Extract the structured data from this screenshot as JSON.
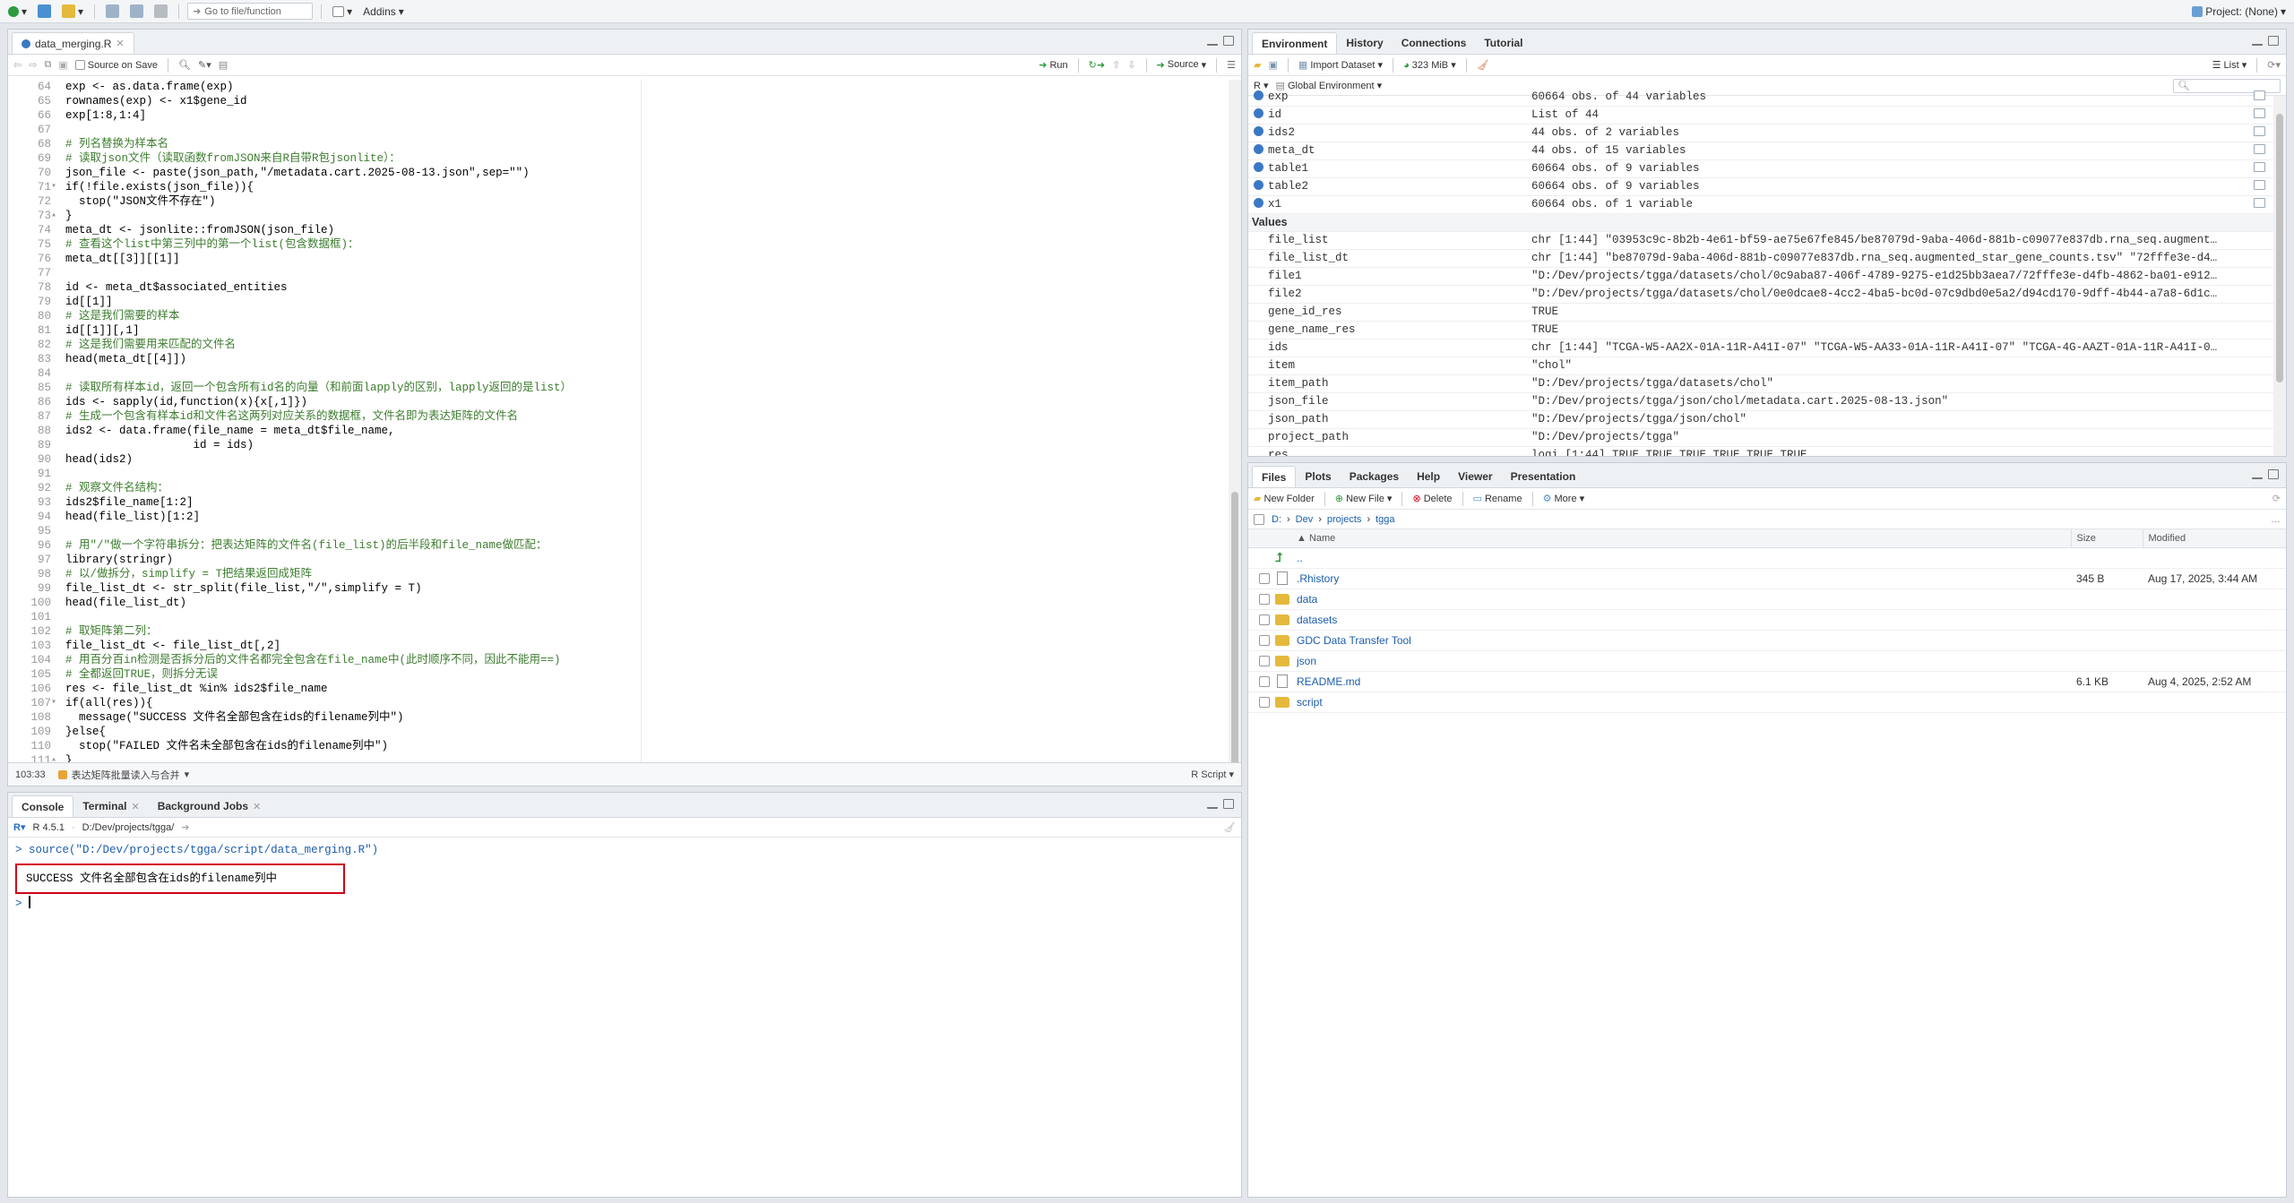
{
  "toolbar": {
    "goto_placeholder": "Go to file/function",
    "addins_label": "Addins",
    "project_label": "Project: (None)"
  },
  "editor": {
    "tab_label": "data_merging.R",
    "source_on_save_label": "Source on Save",
    "run_label": "Run",
    "source_label": "Source",
    "status_position": "103:33",
    "status_section": "表达矩阵批量读入与合并",
    "status_type": "R Script",
    "lines": [
      {
        "n": "64",
        "t": "exp <- as.data.frame(exp)",
        "c": false,
        "f": ""
      },
      {
        "n": "65",
        "t": "rownames(exp) <- x1$gene_id",
        "c": false,
        "f": ""
      },
      {
        "n": "66",
        "t": "exp[1:8,1:4]",
        "c": false,
        "f": ""
      },
      {
        "n": "67",
        "t": "",
        "c": false,
        "f": ""
      },
      {
        "n": "68",
        "t": "# 列名替换为样本名",
        "c": true,
        "f": ""
      },
      {
        "n": "69",
        "t": "# 读取json文件（读取函数fromJSON来自R自带R包jsonlite）：",
        "c": true,
        "f": ""
      },
      {
        "n": "70",
        "t": "json_file <- paste(json_path,\"/metadata.cart.2025-08-13.json\",sep=\"\")",
        "c": false,
        "f": ""
      },
      {
        "n": "71",
        "t": "if(!file.exists(json_file)){",
        "c": false,
        "f": "▾"
      },
      {
        "n": "72",
        "t": "  stop(\"JSON文件不存在\")",
        "c": false,
        "f": ""
      },
      {
        "n": "73",
        "t": "}",
        "c": false,
        "f": "▴"
      },
      {
        "n": "74",
        "t": "meta_dt <- jsonlite::fromJSON(json_file)",
        "c": false,
        "f": ""
      },
      {
        "n": "75",
        "t": "# 查看这个list中第三列中的第一个list(包含数据框)：",
        "c": true,
        "f": ""
      },
      {
        "n": "76",
        "t": "meta_dt[[3]][[1]]",
        "c": false,
        "f": ""
      },
      {
        "n": "77",
        "t": "",
        "c": false,
        "f": ""
      },
      {
        "n": "78",
        "t": "id <- meta_dt$associated_entities",
        "c": false,
        "f": ""
      },
      {
        "n": "79",
        "t": "id[[1]]",
        "c": false,
        "f": ""
      },
      {
        "n": "80",
        "t": "# 这是我们需要的样本",
        "c": true,
        "f": ""
      },
      {
        "n": "81",
        "t": "id[[1]][,1]",
        "c": false,
        "f": ""
      },
      {
        "n": "82",
        "t": "# 这是我们需要用来匹配的文件名",
        "c": true,
        "f": ""
      },
      {
        "n": "83",
        "t": "head(meta_dt[[4]])",
        "c": false,
        "f": ""
      },
      {
        "n": "84",
        "t": "",
        "c": false,
        "f": ""
      },
      {
        "n": "85",
        "t": "# 读取所有样本id，返回一个包含所有id名的向量（和前面lapply的区别，lapply返回的是list）",
        "c": true,
        "f": ""
      },
      {
        "n": "86",
        "t": "ids <- sapply(id,function(x){x[,1]})",
        "c": false,
        "f": ""
      },
      {
        "n": "87",
        "t": "# 生成一个包含有样本id和文件名这两列对应关系的数据框，文件名即为表达矩阵的文件名",
        "c": true,
        "f": ""
      },
      {
        "n": "88",
        "t": "ids2 <- data.frame(file_name = meta_dt$file_name,",
        "c": false,
        "f": ""
      },
      {
        "n": "89",
        "t": "                   id = ids)",
        "c": false,
        "f": ""
      },
      {
        "n": "90",
        "t": "head(ids2)",
        "c": false,
        "f": ""
      },
      {
        "n": "91",
        "t": "",
        "c": false,
        "f": ""
      },
      {
        "n": "92",
        "t": "# 观察文件名结构：",
        "c": true,
        "f": ""
      },
      {
        "n": "93",
        "t": "ids2$file_name[1:2]",
        "c": false,
        "f": ""
      },
      {
        "n": "94",
        "t": "head(file_list)[1:2]",
        "c": false,
        "f": ""
      },
      {
        "n": "95",
        "t": "",
        "c": false,
        "f": ""
      },
      {
        "n": "96",
        "t": "# 用\"/\"做一个字符串拆分：把表达矩阵的文件名(file_list)的后半段和file_name做匹配：",
        "c": true,
        "f": ""
      },
      {
        "n": "97",
        "t": "library(stringr)",
        "c": false,
        "f": ""
      },
      {
        "n": "98",
        "t": "# 以/做拆分，simplify = T把结果返回成矩阵",
        "c": true,
        "f": ""
      },
      {
        "n": "99",
        "t": "file_list_dt <- str_split(file_list,\"/\",simplify = T)",
        "c": false,
        "f": ""
      },
      {
        "n": "100",
        "t": "head(file_list_dt)",
        "c": false,
        "f": ""
      },
      {
        "n": "101",
        "t": "",
        "c": false,
        "f": ""
      },
      {
        "n": "102",
        "t": "# 取矩阵第二列：",
        "c": true,
        "f": ""
      },
      {
        "n": "103",
        "t": "file_list_dt <- file_list_dt[,2]",
        "c": false,
        "f": ""
      },
      {
        "n": "104",
        "t": "# 用百分百in检测是否拆分后的文件名都完全包含在file_name中(此时顺序不同，因此不能用==)",
        "c": true,
        "f": ""
      },
      {
        "n": "105",
        "t": "# 全都返回TRUE，则拆分无误",
        "c": true,
        "f": ""
      },
      {
        "n": "106",
        "t": "res <- file_list_dt %in% ids2$file_name",
        "c": false,
        "f": ""
      },
      {
        "n": "107",
        "t": "if(all(res)){",
        "c": false,
        "f": "▾"
      },
      {
        "n": "108",
        "t": "  message(\"SUCCESS 文件名全部包含在ids的filename列中\")",
        "c": false,
        "f": ""
      },
      {
        "n": "109",
        "t": "}else{",
        "c": false,
        "f": ""
      },
      {
        "n": "110",
        "t": "  stop(\"FAILED 文件名未全部包含在ids的filename列中\")",
        "c": false,
        "f": ""
      },
      {
        "n": "111",
        "t": "}",
        "c": false,
        "f": "▴"
      },
      {
        "n": "112",
        "t": "",
        "c": false,
        "f": ""
      }
    ]
  },
  "environment": {
    "tabs": [
      "Environment",
      "History",
      "Connections",
      "Tutorial"
    ],
    "import_label": "Import Dataset",
    "memory_label": "323 MiB",
    "view_label": "List",
    "lang_label": "R",
    "scope_label": "Global Environment",
    "data_rows": [
      {
        "name": "exp",
        "value": "60664 obs. of 44 variables"
      },
      {
        "name": "id",
        "value": "List of  44"
      },
      {
        "name": "ids2",
        "value": "44 obs. of 2 variables"
      },
      {
        "name": "meta_dt",
        "value": "44 obs. of 15 variables"
      },
      {
        "name": "table1",
        "value": "60664 obs. of 9 variables"
      },
      {
        "name": "table2",
        "value": "60664 obs. of 9 variables"
      },
      {
        "name": "x1",
        "value": "60664 obs. of 1 variable"
      }
    ],
    "values_label": "Values",
    "value_rows": [
      {
        "name": "file_list",
        "value": "chr [1:44] \"03953c9c-8b2b-4e61-bf59-ae75e67fe845/be87079d-9aba-406d-881b-c09077e837db.rna_seq.augment…"
      },
      {
        "name": "file_list_dt",
        "value": "chr [1:44] \"be87079d-9aba-406d-881b-c09077e837db.rna_seq.augmented_star_gene_counts.tsv\" \"72fffe3e-d4…"
      },
      {
        "name": "file1",
        "value": "\"D:/Dev/projects/tgga/datasets/chol/0c9aba87-406f-4789-9275-e1d25bb3aea7/72fffe3e-d4fb-4862-ba01-e912…"
      },
      {
        "name": "file2",
        "value": "\"D:/Dev/projects/tgga/datasets/chol/0e0dcae8-4cc2-4ba5-bc0d-07c9dbd0e5a2/d94cd170-9dff-4b44-a7a8-6d1c…"
      },
      {
        "name": "gene_id_res",
        "value": "TRUE"
      },
      {
        "name": "gene_name_res",
        "value": "TRUE"
      },
      {
        "name": "ids",
        "value": "chr [1:44] \"TCGA-W5-AA2X-01A-11R-A41I-07\" \"TCGA-W5-AA33-01A-11R-A41I-07\" \"TCGA-4G-AAZT-01A-11R-A41I-0…"
      },
      {
        "name": "item",
        "value": "\"chol\""
      },
      {
        "name": "item_path",
        "value": "\"D:/Dev/projects/tgga/datasets/chol\""
      },
      {
        "name": "json_file",
        "value": "\"D:/Dev/projects/tgga/json/chol/metadata.cart.2025-08-13.json\""
      },
      {
        "name": "json_path",
        "value": "\"D:/Dev/projects/tgga/json/chol\""
      },
      {
        "name": "project_path",
        "value": "\"D:/Dev/projects/tgga\""
      },
      {
        "name": "res",
        "value": "logi [1:44] TRUE TRUE TRUE TRUE TRUE TRUE ..."
      }
    ]
  },
  "files": {
    "tabs": [
      "Files",
      "Plots",
      "Packages",
      "Help",
      "Viewer",
      "Presentation"
    ],
    "new_folder_label": "New Folder",
    "new_file_label": "New File",
    "delete_label": "Delete",
    "rename_label": "Rename",
    "more_label": "More",
    "breadcrumb": [
      "D:",
      "Dev",
      "projects",
      "tgga"
    ],
    "col_name": "Name",
    "col_size": "Size",
    "col_modified": "Modified",
    "rows": [
      {
        "name": "..",
        "type": "up",
        "size": "",
        "modified": ""
      },
      {
        "name": ".Rhistory",
        "type": "file",
        "size": "345 B",
        "modified": "Aug 17, 2025, 3:44 AM"
      },
      {
        "name": "data",
        "type": "folder",
        "size": "",
        "modified": ""
      },
      {
        "name": "datasets",
        "type": "folder",
        "size": "",
        "modified": ""
      },
      {
        "name": "GDC Data Transfer Tool",
        "type": "folder",
        "size": "",
        "modified": ""
      },
      {
        "name": "json",
        "type": "folder",
        "size": "",
        "modified": ""
      },
      {
        "name": "README.md",
        "type": "file",
        "size": "6.1 KB",
        "modified": "Aug 4, 2025, 2:52 AM"
      },
      {
        "name": "script",
        "type": "folder",
        "size": "",
        "modified": ""
      }
    ]
  },
  "console": {
    "tabs": [
      "Console",
      "Terminal",
      "Background Jobs"
    ],
    "r_version": "R 4.5.1",
    "path": "D:/Dev/projects/tgga/",
    "command_prompt": ">",
    "command": "source(\"D:/Dev/projects/tgga/script/data_merging.R\")",
    "output": "SUCCESS 文件名全部包含在ids的filename列中",
    "prompt": ">"
  }
}
